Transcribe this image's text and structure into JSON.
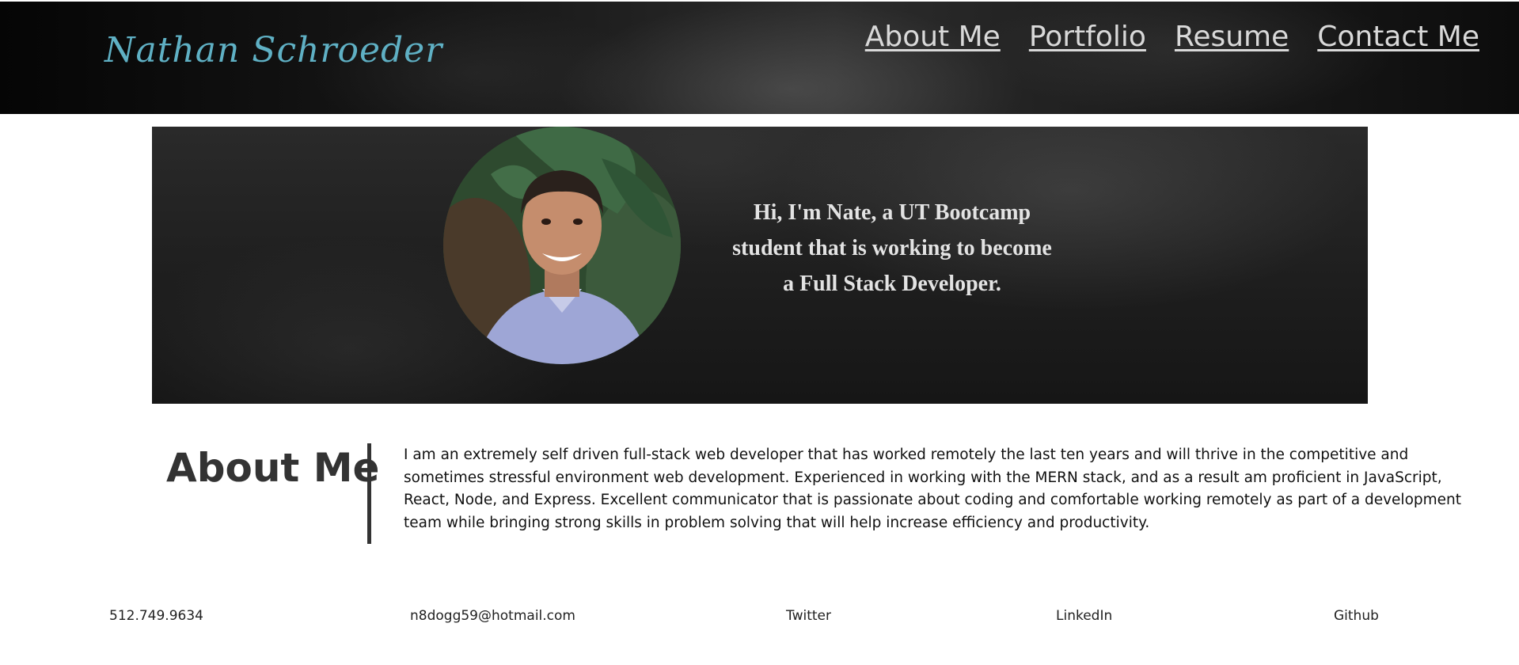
{
  "header": {
    "logo": "Nathan Schroeder",
    "nav": [
      "About Me",
      "Portfolio",
      "Resume",
      "Contact Me"
    ]
  },
  "hero": {
    "lines": [
      "Hi, I'm Nate, a UT Bootcamp",
      "student that is working to become",
      "a Full Stack Developer."
    ]
  },
  "about": {
    "heading": "About Me",
    "body": "I am an extremely self driven full-stack web developer that has worked remotely the last ten years and will thrive in the competitive and sometimes stressful environment web development. Experienced in working with the MERN stack, and as a result am proficient in JavaScript, React, Node, and Express. Excellent communicator that is passionate about coding and comfortable working remotely as part of a development team while bringing strong skills in problem solving that will help increase efficiency and productivity."
  },
  "footer": {
    "phone": "512.749.9634",
    "email": "n8dogg59@hotmail.com",
    "twitter": "Twitter",
    "linkedin": "LinkedIn",
    "github": "Github"
  },
  "colors": {
    "logo": "#5fb0c4",
    "nav": "#d9d9d9",
    "heading": "#333333"
  }
}
